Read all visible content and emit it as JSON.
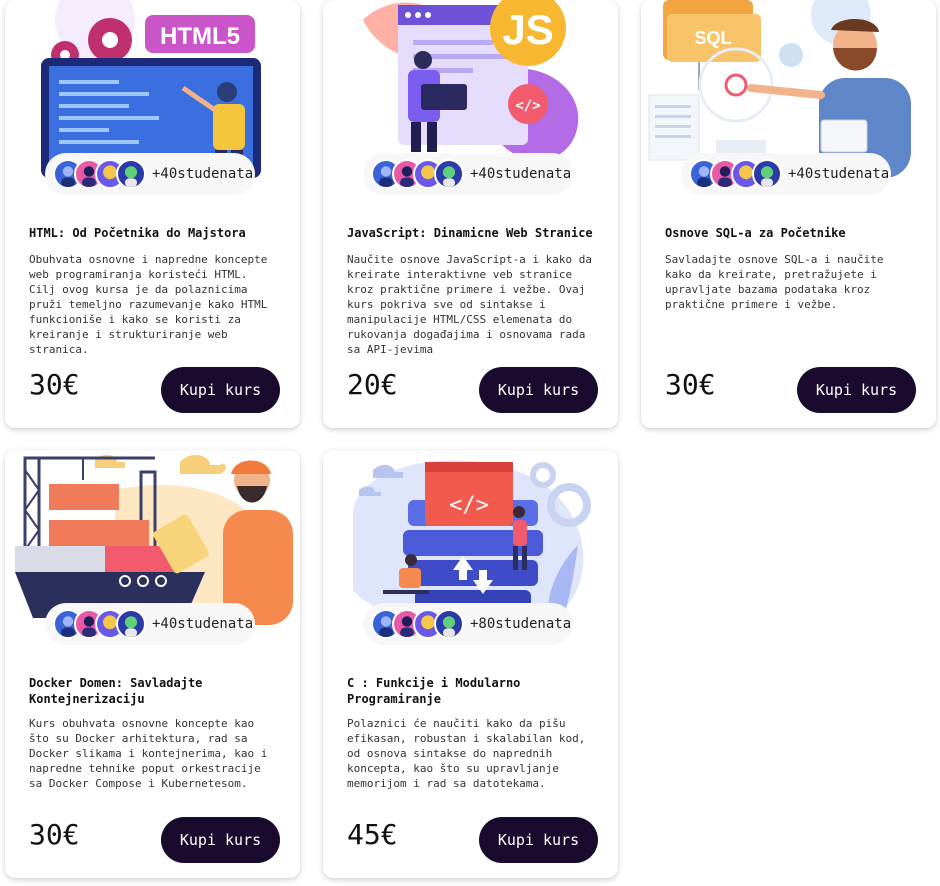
{
  "courses": [
    {
      "title": "HTML: Od Početnika do Majstora",
      "description": "Obuhvata osnovne i napredne koncepte web programiranja koristeći HTML. Cilj ovog kursa je da polaznicima pruži temeljno razumevanje kako HTML funkcioniše i kako se koristi za kreiranje i strukturiranje web stranica.",
      "price": "30€",
      "students": "+40studenata",
      "buy_label": "Kupi kurs",
      "badge_text": "HTML5"
    },
    {
      "title": "JavaScript: Dinamicne Web Stranice",
      "description": "Naučite osnove JavaScript-a i kako da kreirate interaktivne veb stranice kroz praktične primere i vežbe. Ovaj kurs pokriva sve od sintakse i manipulacije HTML/CSS elemenata do rukovanja događajima i osnovama rada sa API-jevima",
      "price": "20€",
      "students": "+40studenata",
      "buy_label": "Kupi kurs",
      "badge_text": "JS"
    },
    {
      "title": "Osnove SQL-a za Početnike",
      "description": "Savladajte osnove SQL-a i naučite kako da kreirate, pretražujete i upravljate bazama podataka kroz praktične primere i vežbe.",
      "price": "30€",
      "students": "+40studenata",
      "buy_label": "Kupi kurs",
      "badge_text": "SQL"
    },
    {
      "title": "Docker Domen: Savladajte Kontejnerizaciju",
      "description": "Kurs obuhvata osnovne koncepte kao što su Docker arhitektura, rad sa Docker slikama i kontejnerima, kao i napredne tehnike poput orkestracije sa Docker Compose i Kubernetesom.",
      "price": "30€",
      "students": "+40studenata",
      "buy_label": "Kupi kurs"
    },
    {
      "title": "C : Funkcije i Modularno Programiranje",
      "description": "Polaznici će naučiti kako da pišu efikasan, robustan i skalabilan kod, od osnova sintakse do naprednih koncepta, kao što su upravljanje memorijom i rad sa datotekama.",
      "price": "45€",
      "students": "+80studenata",
      "buy_label": "Kupi kurs"
    }
  ],
  "colors": {
    "button_bg": "#1a0b2e",
    "button_text": "#ffffff",
    "card_bg": "#ffffff",
    "pill_bg": "#f7f7f8"
  }
}
